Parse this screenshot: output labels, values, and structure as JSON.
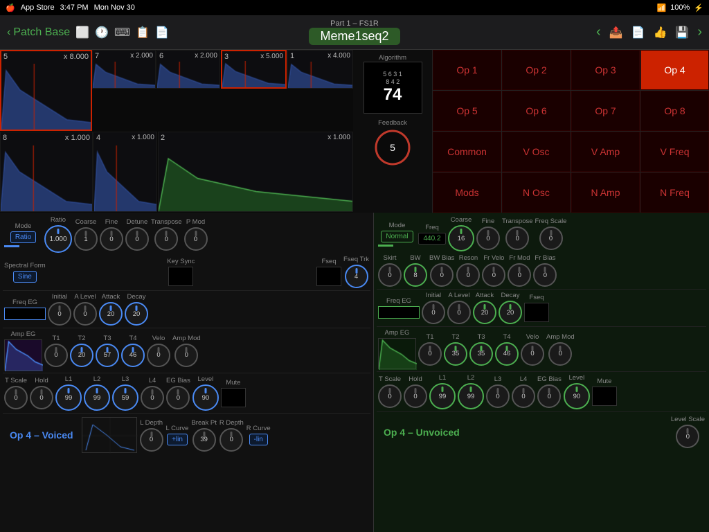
{
  "statusBar": {
    "appStore": "App Store",
    "time": "3:47 PM",
    "date": "Mon Nov 30",
    "wifi": "WiFi",
    "battery": "100%",
    "charging": true
  },
  "navBar": {
    "backLabel": "Patch Base",
    "part": "Part 1 – FS1R",
    "patchName": "Meme1seq2",
    "icons": [
      "window",
      "history",
      "keyboard",
      "copy",
      "paste"
    ]
  },
  "algorithm": {
    "title": "Algorithm",
    "displayLines": [
      "5 6 3 1",
      "8 4 2"
    ],
    "number": "74",
    "feedbackLabel": "Feedback",
    "feedbackValue": "5"
  },
  "opGrid": {
    "cells": [
      {
        "label": "Op 1",
        "active": false
      },
      {
        "label": "Op 2",
        "active": false
      },
      {
        "label": "Op 3",
        "active": false
      },
      {
        "label": "Op 4",
        "active": true
      },
      {
        "label": "Op 5",
        "active": false
      },
      {
        "label": "Op 6",
        "active": false
      },
      {
        "label": "Op 7",
        "active": false
      },
      {
        "label": "Op 8",
        "active": false
      },
      {
        "label": "Common",
        "active": false
      },
      {
        "label": "V Osc",
        "active": false
      },
      {
        "label": "V Amp",
        "active": false
      },
      {
        "label": "V Freq",
        "active": false
      },
      {
        "label": "Mods",
        "active": false
      },
      {
        "label": "N Osc",
        "active": false
      },
      {
        "label": "N Amp",
        "active": false
      },
      {
        "label": "N Freq",
        "active": false
      }
    ]
  },
  "envelopes": [
    {
      "label": "5",
      "mult": "x 8.000",
      "color": "blue",
      "selected": false
    },
    {
      "label": "7",
      "mult": "x 2.000",
      "color": "blue",
      "selected": false
    },
    {
      "label": "6",
      "mult": "x 2.000",
      "color": "blue",
      "selected": false
    },
    {
      "label": "3",
      "mult": "x 5.000",
      "color": "blue",
      "selected": true
    },
    {
      "label": "1",
      "mult": "x 4.000",
      "color": "blue",
      "selected": false
    },
    {
      "label": "8",
      "mult": "x 1.000",
      "color": "blue",
      "selected": false
    },
    {
      "label": "4",
      "mult": "x 1.000",
      "color": "blue",
      "selected": false
    },
    {
      "label": "2",
      "mult": "x 1.000",
      "color": "green",
      "selected": false
    }
  ],
  "leftPanel": {
    "voicedLabel": "Op 4 – Voiced",
    "params": {
      "modeLabel": "Mode",
      "ratioLabel": "Ratio",
      "coarseLabel": "Coarse",
      "fineLabel": "Fine",
      "detuneLabel": "Detune",
      "transposeLabel": "Transpose",
      "pModLabel": "P Mod",
      "modeValue": "Ratio",
      "ratioValue": "1.000",
      "coarseValue": "1",
      "fineValue": "0",
      "detuneValue": "0",
      "transposeValue": "0",
      "pModValue": "0",
      "spectralFormLabel": "Spectral Form",
      "spectralFormValue": "Sine",
      "keySyncLabel": "Key Sync",
      "fseqLabel": "Fseq",
      "fseqTrkLabel": "Fseq Trk",
      "fseqTrkValue": "4"
    },
    "freqEG": {
      "label": "Freq EG",
      "initialLabel": "Initial",
      "aLevelLabel": "A Level",
      "attackLabel": "Attack",
      "decayLabel": "Decay",
      "initialValue": "0",
      "aLevelValue": "0",
      "attackValue": "20",
      "decayValue": "20"
    },
    "ampEG": {
      "label": "Amp EG",
      "t1Label": "T1",
      "t2Label": "T2",
      "t3Label": "T3",
      "t4Label": "T4",
      "veloLabel": "Velo",
      "ampModLabel": "Amp Mod",
      "t1Value": "0",
      "t2Value": "20",
      "t3Value": "57",
      "t4Value": "46",
      "veloValue": "0",
      "ampModValue": "0"
    },
    "tScale": {
      "tScaleLabel": "T Scale",
      "holdLabel": "Hold",
      "l1Label": "L1",
      "l2Label": "L2",
      "l3Label": "L3",
      "l4Label": "L4",
      "egBiasLabel": "EG Bias",
      "levelLabel": "Level",
      "muteLabel": "Mute",
      "tScaleValue": "0",
      "holdValue": "0",
      "l1Value": "99",
      "l2Value": "99",
      "l3Value": "59",
      "l4Value": "0",
      "egBiasValue": "0",
      "levelValue": "90",
      "muteValue": ""
    },
    "bottomBar": {
      "lDepthLabel": "L Depth",
      "lCurveLabel": "L Curve",
      "breakPtLabel": "Break Pt",
      "rDepthLabel": "R Depth",
      "rCurveLabel": "R Curve",
      "lDepthValue": "0",
      "lCurveValue": "+lin",
      "breakPtValue": "39",
      "rDepthValue": "0",
      "rCurveValue": "-lin"
    }
  },
  "rightPanel": {
    "unvoicedLabel": "Op 4 – Unvoiced",
    "params": {
      "modeLabel": "Mode",
      "freqLabel": "Freq",
      "coarseLabel": "Coarse",
      "fineLabel": "Fine",
      "transposeLabel": "Transpose",
      "freqScaleLabel": "Freq Scale",
      "modeValue": "Normal",
      "freqValue": "440.2",
      "coarseValue": "16",
      "fineValue": "0",
      "transposeValue": "0",
      "freqScaleValue": "0",
      "skirtLabel": "Skirt",
      "bwLabel": "BW",
      "bwBiasLabel": "BW Bias",
      "resonLabel": "Reson",
      "frVeloLabel": "Fr Velo",
      "frModLabel": "Fr Mod",
      "frBiasLabel": "Fr Bias",
      "skirtValue": "0",
      "bwValue": "8",
      "bwBiasValue": "0",
      "resonValue": "0",
      "frVeloValue": "0",
      "frModValue": "0",
      "frBiasValue": "0"
    },
    "freqEG": {
      "label": "Freq EG",
      "initialLabel": "Initial",
      "aLevelLabel": "A Level",
      "attackLabel": "Attack",
      "decayLabel": "Decay",
      "fseqLabel": "Fseq",
      "initialValue": "0",
      "aLevelValue": "0",
      "attackValue": "20",
      "decayValue": "20"
    },
    "ampEG": {
      "label": "Amp EG",
      "t1Label": "T1",
      "t2Label": "T2",
      "t3Label": "T3",
      "t4Label": "T4",
      "veloLabel": "Velo",
      "ampModLabel": "Amp Mod",
      "t1Value": "0",
      "t2Value": "35",
      "t3Value": "35",
      "t4Value": "46",
      "veloValue": "0",
      "ampModValue": "0"
    },
    "tScale": {
      "tScaleLabel": "T Scale",
      "holdLabel": "Hold",
      "l1Label": "L1",
      "l2Label": "L2",
      "l3Label": "L3",
      "l4Label": "L4",
      "egBiasLabel": "EG Bias",
      "levelLabel": "Level",
      "muteLabel": "Mute",
      "tScaleValue": "0",
      "holdValue": "0",
      "l1Value": "99",
      "l2Value": "99",
      "l3Value": "0",
      "l4Value": "0",
      "egBiasValue": "0",
      "levelValue": "90",
      "muteValue": ""
    },
    "bottomBar": {
      "levelScaleLabel": "Level Scale",
      "levelScaleValue": "0"
    }
  }
}
